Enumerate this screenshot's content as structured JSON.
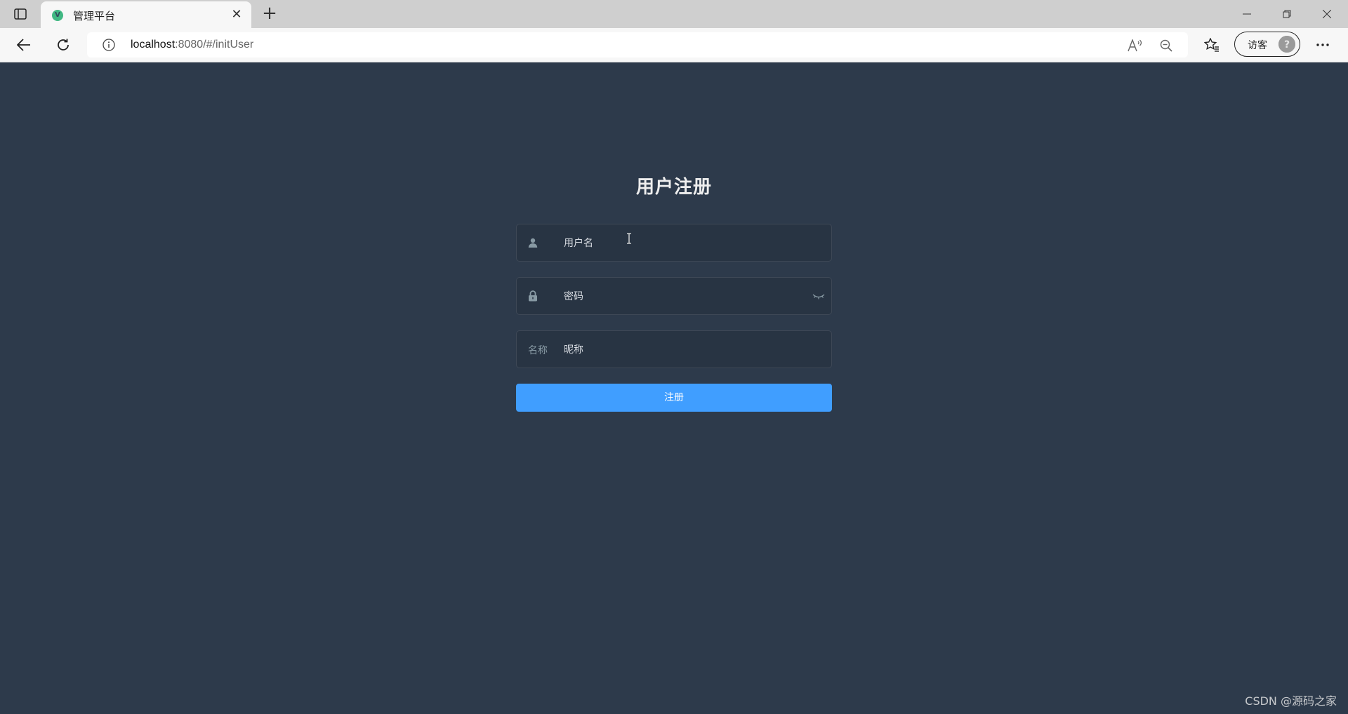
{
  "browser": {
    "tab_title": "管理平台",
    "favicon_letter": "V",
    "url_host": "localhost",
    "url_rest": ":8080/#/initUser",
    "profile_label": "访客"
  },
  "form": {
    "title": "用户注册",
    "username_placeholder": "用户名",
    "password_placeholder": "密码",
    "nickname_prefix": "名称",
    "nickname_placeholder": "昵称",
    "submit_label": "注册"
  },
  "watermark": "CSDN @源码之家",
  "icons": {
    "tab_actions": "tab-actions-icon",
    "close": "close-icon",
    "new_tab": "plus-icon",
    "minimize": "minimize-icon",
    "restore": "restore-icon",
    "window_close": "close-icon",
    "back": "back-arrow-icon",
    "refresh": "refresh-icon",
    "info": "info-icon",
    "read_aloud": "read-aloud-icon",
    "zoom": "zoom-out-icon",
    "favorites": "favorites-icon",
    "more": "more-icon",
    "user": "user-icon",
    "lock": "lock-icon",
    "eye": "eye-closed-icon"
  },
  "colors": {
    "page_bg": "#2d3a4b",
    "button": "#409eff",
    "title": "#eeeeee"
  }
}
